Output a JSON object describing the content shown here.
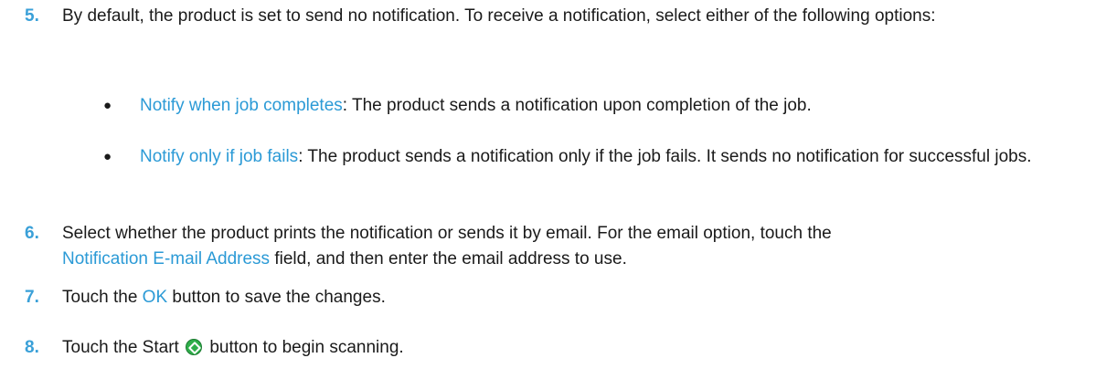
{
  "steps": [
    {
      "number": "5.",
      "text_before": "By default, the product is set to send no notification. To receive a notification, select either of the following options:",
      "options": [
        {
          "bullet": "●",
          "term": "Notify when job completes",
          "desc": ": The product sends a notification upon completion of the job."
        },
        {
          "bullet": "●",
          "term": "Notify only if job fails",
          "desc": ": The product sends a notification only if the job fails. It sends no notification for successful jobs."
        }
      ]
    },
    {
      "number": "6.",
      "text_a": "Select whether the product prints the notification or sends it by email. For the email option, touch the",
      "term": "Notification E-mail Address",
      "text_b": " field, and then enter the email address to use."
    },
    {
      "number": "7.",
      "text_a": "Touch the ",
      "term": "OK",
      "text_b": " button to save the changes."
    },
    {
      "number": "8.",
      "text_a": "Touch the Start ",
      "icon": "start-button-icon",
      "text_b": " button to begin scanning."
    }
  ],
  "colors": {
    "accent": "#2b9ad6",
    "step_number": "#3aa0d8",
    "start_icon": "#2fae4a"
  }
}
